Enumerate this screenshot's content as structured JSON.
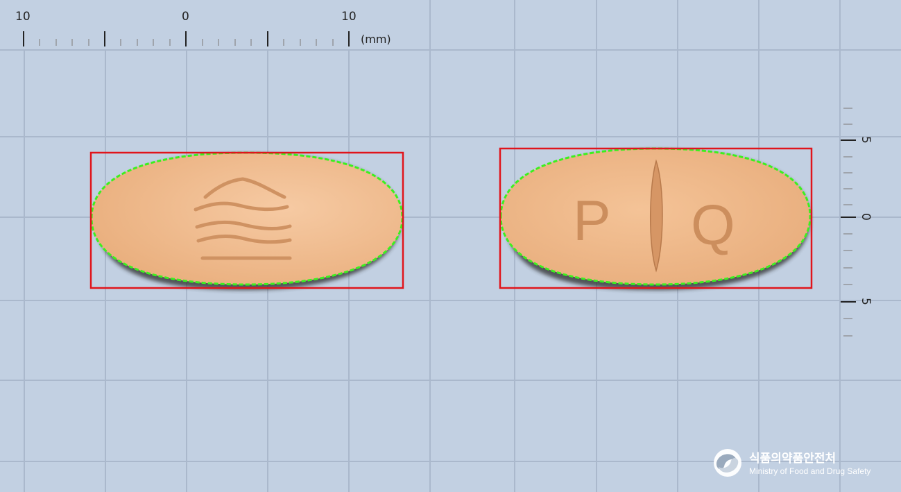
{
  "colors": {
    "background": "#c2d0e2",
    "grid_line": "#a9b8cc",
    "pill_fill": "#efb887",
    "pill_highlight": "#f6caa3",
    "pill_shadow": "#2b2a2a",
    "engraving": "#c98c5a",
    "bounding_box": "#e0141b",
    "contour_points": "#3cf01e"
  },
  "top_ruler": {
    "labels": [
      "10",
      "0",
      "10"
    ],
    "unit": "(mm)"
  },
  "side_ruler": {
    "labels": [
      "5",
      "0",
      "5"
    ]
  },
  "pills": {
    "front": {
      "imprint": "wave-lines"
    },
    "back": {
      "left_letter": "P",
      "right_letter": "Q",
      "score": "score-line"
    }
  },
  "logo": {
    "korean": "식품의약품안전처",
    "english": "Ministry of Food and Drug Safety"
  }
}
